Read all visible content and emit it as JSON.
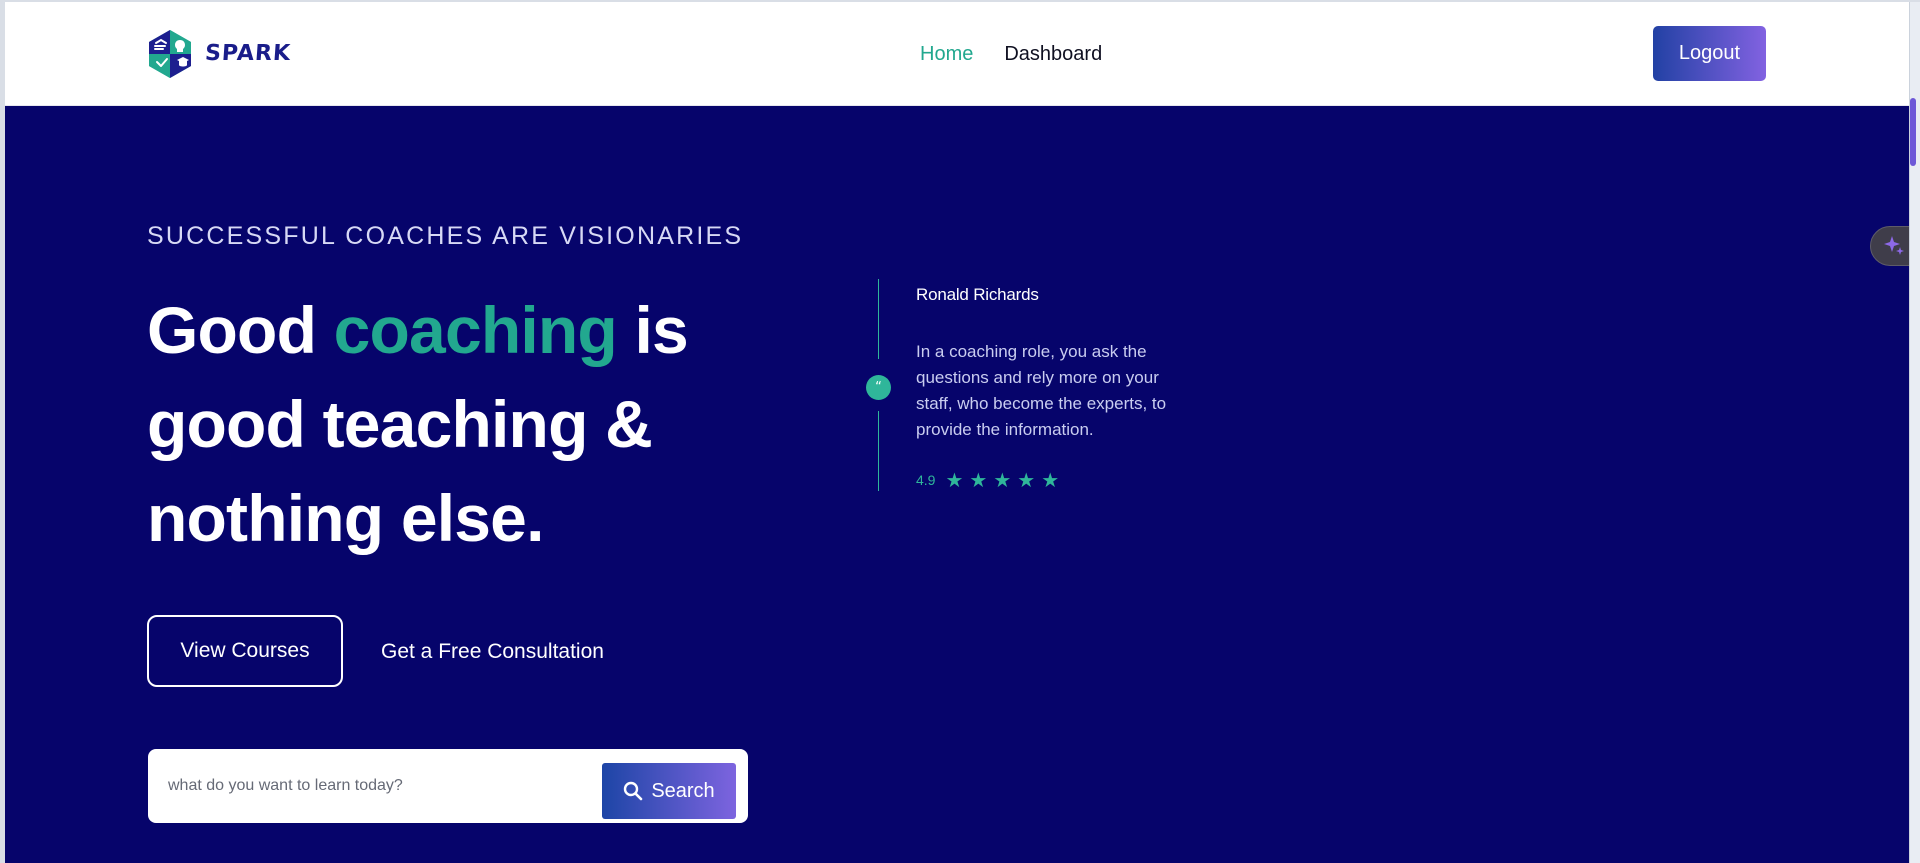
{
  "brand": {
    "name": "SPARK"
  },
  "nav": {
    "items": [
      {
        "label": "Home"
      },
      {
        "label": "Dashboard"
      }
    ]
  },
  "header": {
    "logout_label": "Logout"
  },
  "hero": {
    "kicker": "SUCCESSFUL COACHES ARE VISIONARIES",
    "title_part_1": "Good ",
    "title_accent": "coaching",
    "title_part_2": " is good teaching & nothing else.",
    "primary_button": "View Courses",
    "secondary_link": "Get a Free Consultation"
  },
  "search": {
    "placeholder": "what do you want to learn today?",
    "button_label": "Search"
  },
  "testimonial": {
    "quote_icon": "quote-icon",
    "name": "Ronald Richards",
    "text": "In a coaching role, you ask the questions and rely more on your staff, who become the experts, to provide the information.",
    "rating_value": "4.9",
    "star_count": 5
  },
  "floating_helper": {
    "icon": "sparkles-icon"
  },
  "colors": {
    "background": "#06046b",
    "accent_teal": "#22a88f",
    "button_gradient_start": "#2241a4",
    "button_gradient_end": "#8262e1",
    "logo_blue": "#1a1d8a"
  }
}
